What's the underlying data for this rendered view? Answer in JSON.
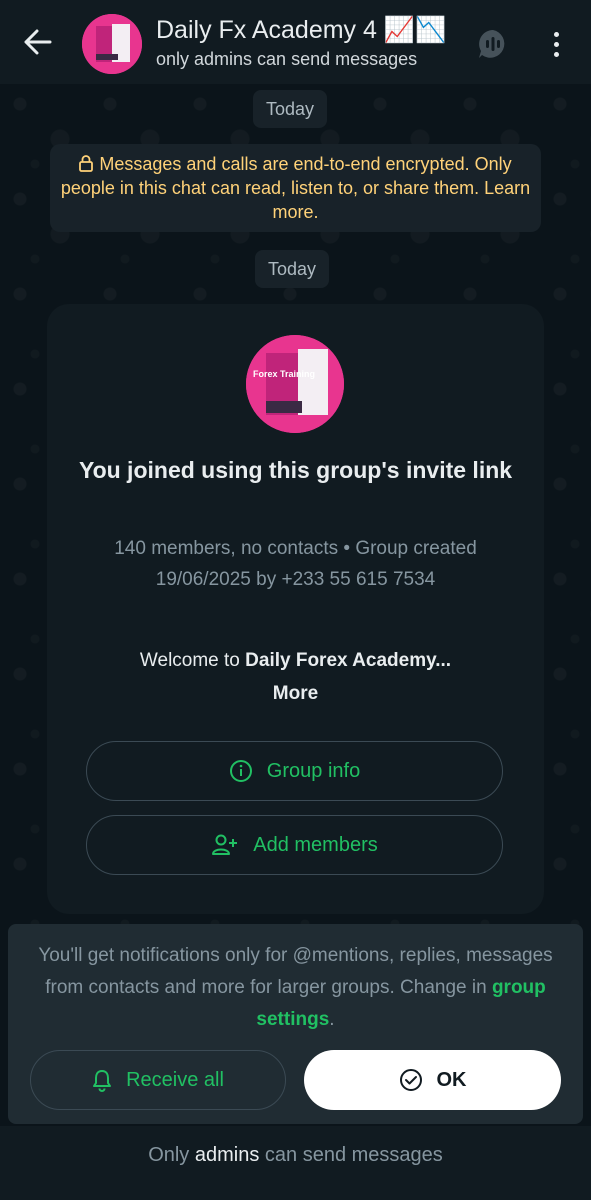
{
  "header": {
    "title": "Daily Fx Academy 4 📈📉",
    "subtitle": "only admins can send messages",
    "back_icon": "arrow-left-icon",
    "call_icon": "voice-chat-icon",
    "menu_icon": "more-vertical-icon"
  },
  "chat": {
    "date_chip_1": "Today",
    "encryption_notice": "Messages and calls are end-to-end encrypted. Only people in this chat can read, listen to, or share them. Learn more.",
    "date_chip_2": "Today"
  },
  "card": {
    "avatar_text": "Forex Training",
    "title": "You joined using this group's invite link",
    "meta": "140 members, no contacts • Group created 19/06/2025 by +233 55 615 7534",
    "welcome_prefix": "Welcome to",
    "welcome_name": "Daily Forex Academy...",
    "welcome_more": "More",
    "group_info_label": "Group info",
    "add_members_label": "Add members"
  },
  "notification": {
    "text_before": "You'll get notifications only for @mentions, replies, messages from contacts and more for larger groups. Change in",
    "link": "group settings",
    "text_after": ".",
    "receive_all_label": "Receive all",
    "ok_label": "OK"
  },
  "footer": {
    "prefix": "Only",
    "admins": "admins",
    "suffix": "can send messages"
  },
  "colors": {
    "accent": "#21c063",
    "background": "#0b141a",
    "warning": "#ffd279"
  }
}
